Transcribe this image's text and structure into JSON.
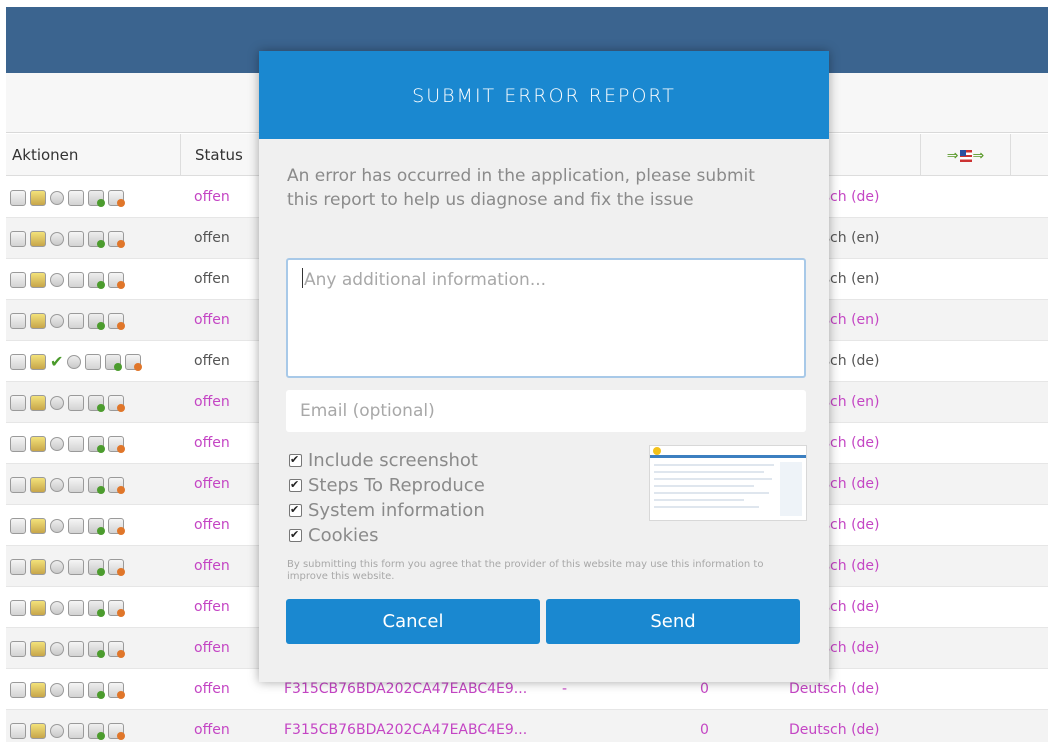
{
  "table": {
    "headers": {
      "actions": "Aktionen",
      "status": "Status"
    },
    "rows": [
      {
        "status": "offen",
        "lang": "Deutsch (de)",
        "status_color": "pink",
        "lang_color": "pink",
        "check": false
      },
      {
        "status": "offen",
        "lang": "Deutsch (en)",
        "status_color": "gray",
        "lang_color": "gray",
        "check": false
      },
      {
        "status": "offen",
        "lang": "Deutsch (en)",
        "status_color": "gray",
        "lang_color": "gray",
        "check": false
      },
      {
        "status": "offen",
        "lang": "Deutsch (en)",
        "status_color": "pink",
        "lang_color": "pink",
        "check": false
      },
      {
        "status": "offen",
        "lang": "Deutsch (de)",
        "status_color": "gray",
        "lang_color": "gray",
        "check": true
      },
      {
        "status": "offen",
        "lang": "Deutsch (en)",
        "status_color": "pink",
        "lang_color": "pink",
        "check": false
      },
      {
        "status": "offen",
        "lang": "Deutsch (de)",
        "status_color": "pink",
        "lang_color": "pink",
        "check": false
      },
      {
        "status": "offen",
        "lang": "Deutsch (de)",
        "status_color": "pink",
        "lang_color": "pink",
        "check": false
      },
      {
        "status": "offen",
        "lang": "Deutsch (de)",
        "status_color": "pink",
        "lang_color": "pink",
        "check": false
      },
      {
        "status": "offen",
        "lang": "Deutsch (de)",
        "status_color": "pink",
        "lang_color": "pink",
        "check": false
      },
      {
        "status": "offen",
        "lang": "Deutsch (de)",
        "status_color": "pink",
        "lang_color": "pink",
        "check": false
      },
      {
        "status": "offen",
        "lang": "Deutsch (de)",
        "status_color": "pink",
        "lang_color": "pink",
        "check": false
      },
      {
        "status": "offen",
        "lang": "Deutsch (de)",
        "status_color": "pink",
        "lang_color": "pink",
        "check": false,
        "hash": "F315CB76BDA202CA47EABC4E9...",
        "dash": "-",
        "num": "0"
      },
      {
        "status": "offen",
        "lang": "Deutsch (de)",
        "status_color": "pink",
        "lang_color": "pink",
        "check": false,
        "hash": "F315CB76BDA202CA47EABC4E9...",
        "num": "0"
      }
    ]
  },
  "dialog": {
    "title": "SUBMIT ERROR REPORT",
    "message": "An error has occurred in the application, please submit this report to help us diagnose and fix the issue",
    "additional_placeholder": "Any additional information...",
    "email_placeholder": "Email (optional)",
    "options": [
      {
        "label": "Include screenshot",
        "checked": true
      },
      {
        "label": "Steps To Reproduce",
        "checked": true
      },
      {
        "label": "System information",
        "checked": true
      },
      {
        "label": "Cookies",
        "checked": true
      }
    ],
    "legal": "By submitting this form you agree that the provider of this website may use this information to improve this website.",
    "cancel_label": "Cancel",
    "send_label": "Send"
  },
  "colors": {
    "header_blue": "#3b648f",
    "dialog_blue": "#1a88d0",
    "link_pink": "#c445c4"
  },
  "icons": [
    "view-icon",
    "edit-icon",
    "circle-icon",
    "document-icon",
    "forward-icon",
    "delete-document-icon",
    "checkmark-icon",
    "language-swap-icon"
  ]
}
